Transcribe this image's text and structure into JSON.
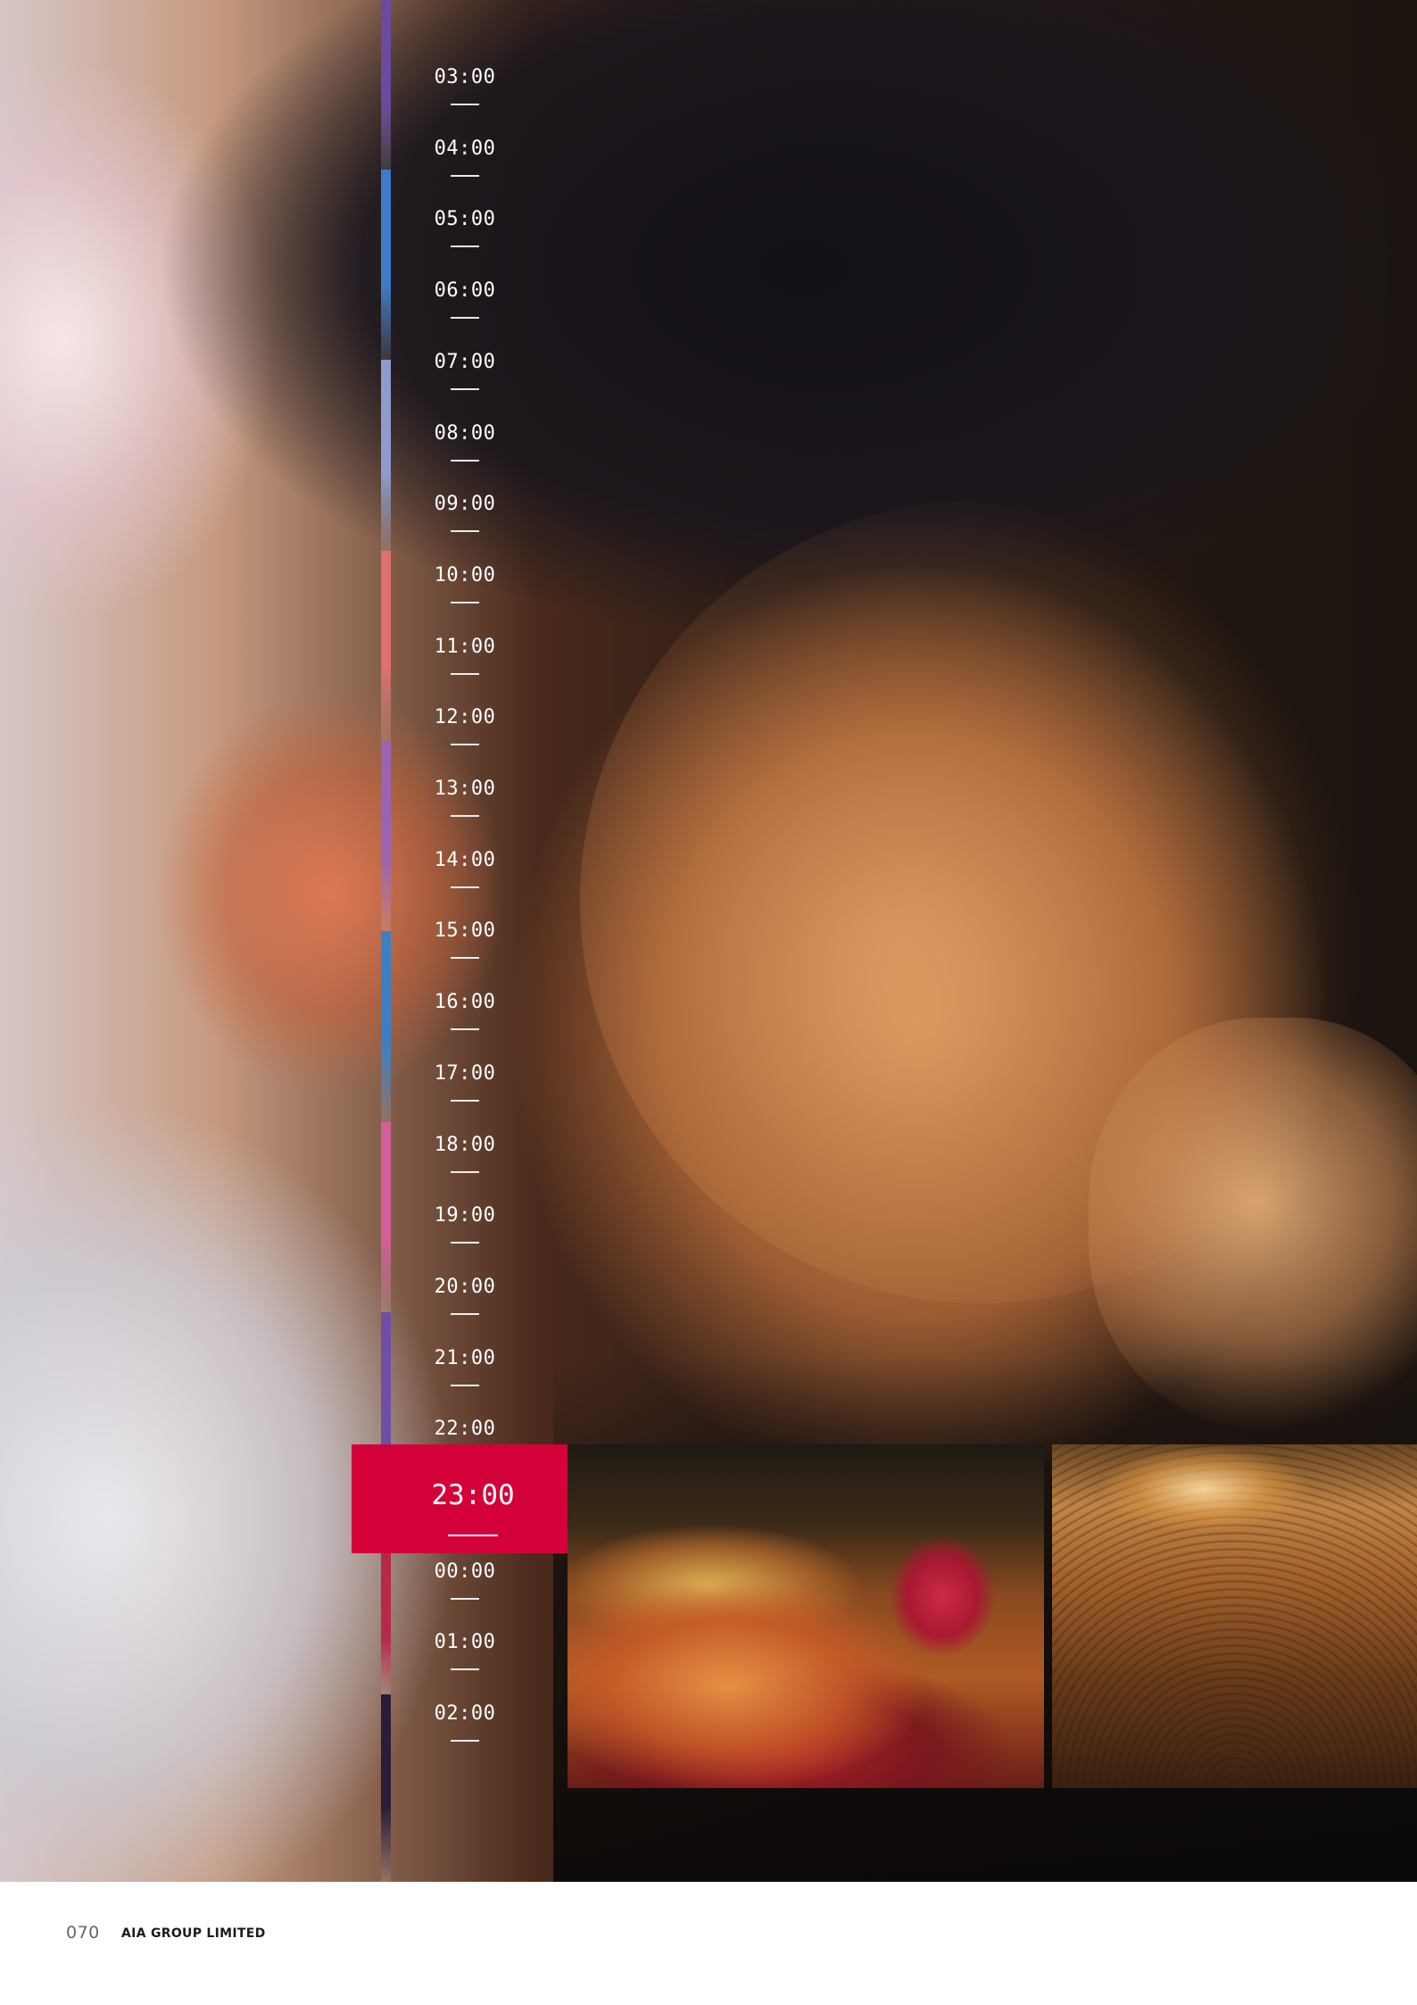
{
  "timeline": {
    "hours": [
      "03:00",
      "04:00",
      "05:00",
      "06:00",
      "07:00",
      "08:00",
      "09:00",
      "10:00",
      "11:00",
      "12:00",
      "13:00",
      "14:00",
      "15:00",
      "16:00",
      "17:00",
      "18:00",
      "19:00",
      "20:00",
      "21:00",
      "22:00",
      "23:00",
      "00:00",
      "01:00",
      "02:00"
    ],
    "highlighted": "23:00",
    "highlight_color": "#d4003a",
    "bar_colors": [
      "#6b4aa0",
      "#3f7cc8",
      "#8e9bcc",
      "#e07070",
      "#9b64b2",
      "#3d7fc4",
      "#d35f9a",
      "#6d4fa8",
      "#b7294a",
      "#2b1c3a"
    ]
  },
  "footer": {
    "page_number": "070",
    "company": "AIA GROUP LIMITED"
  }
}
